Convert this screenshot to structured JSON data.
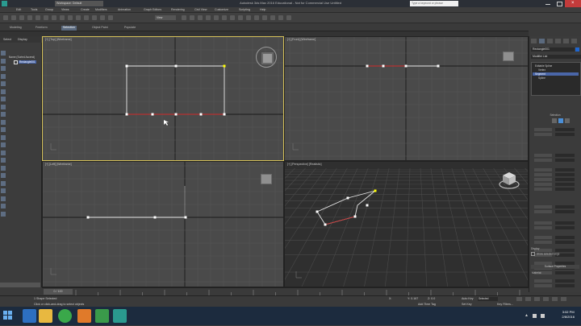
{
  "window": {
    "title": "Autodesk 3ds Max 2016 Educational - Not for Commercial Use     Untitled",
    "workspace": "Workspace: Default",
    "search_placeholder": "Type a keyword or phrase"
  },
  "menu": [
    "Edit",
    "Tools",
    "Group",
    "Views",
    "Create",
    "Modifiers",
    "Animation",
    "Graph Editors",
    "Rendering",
    "Civil View",
    "Customize",
    "Scripting",
    "Help"
  ],
  "toolbar": {
    "view_select": "View"
  },
  "ribbon": {
    "tabs": [
      "Modeling",
      "Freeform",
      "Selection",
      "Object Paint",
      "Populate"
    ],
    "active": "Selection"
  },
  "scene_explorer": {
    "tabs": [
      "Select",
      "Display"
    ],
    "items": [
      "Name (Sorted Ascend)",
      "Rectangle001"
    ]
  },
  "viewports": [
    {
      "label": "[+] [Top] [Wireframe]",
      "active": true
    },
    {
      "label": "[+] [Front] [Wireframe]",
      "active": false
    },
    {
      "label": "[+] [Left] [Wireframe]",
      "active": false
    },
    {
      "label": "[+] [Perspective] [Realistic]",
      "active": false
    }
  ],
  "command_panel": {
    "object_name": "Rectangle001",
    "modifier_list": "Modifier List",
    "stack": [
      "Editable Spline",
      "Vertex",
      "Segment",
      "Spline"
    ],
    "stack_selected": "Segment",
    "sections": [
      "Selection",
      "Display",
      "Show selected segs",
      "Surface Properties",
      "Material:"
    ]
  },
  "timeline": {
    "frame": "0 / 100"
  },
  "status": {
    "selection": "1 Shape Selected",
    "prompt": "Click or click-and-drag to select objects",
    "maxscript": "Welcome to M",
    "x": "X:",
    "y": "Y: 0.167",
    "z": "Z: 0.0",
    "auto_key": "Auto Key",
    "set_key": "Set Key",
    "selected": "Selected",
    "add_time_tag": "Add Time Tag",
    "key_filters": "Key Filters..."
  },
  "taskbar": {
    "time": "3:02 PM",
    "date": "2/8/2016"
  },
  "colors": {
    "active_border": "#d6c25a",
    "spline_white": "#e8e8e8",
    "seg_selected": "#d02a2a",
    "vertex": "#ffff00",
    "stack_highlight": "#4a66a8"
  }
}
